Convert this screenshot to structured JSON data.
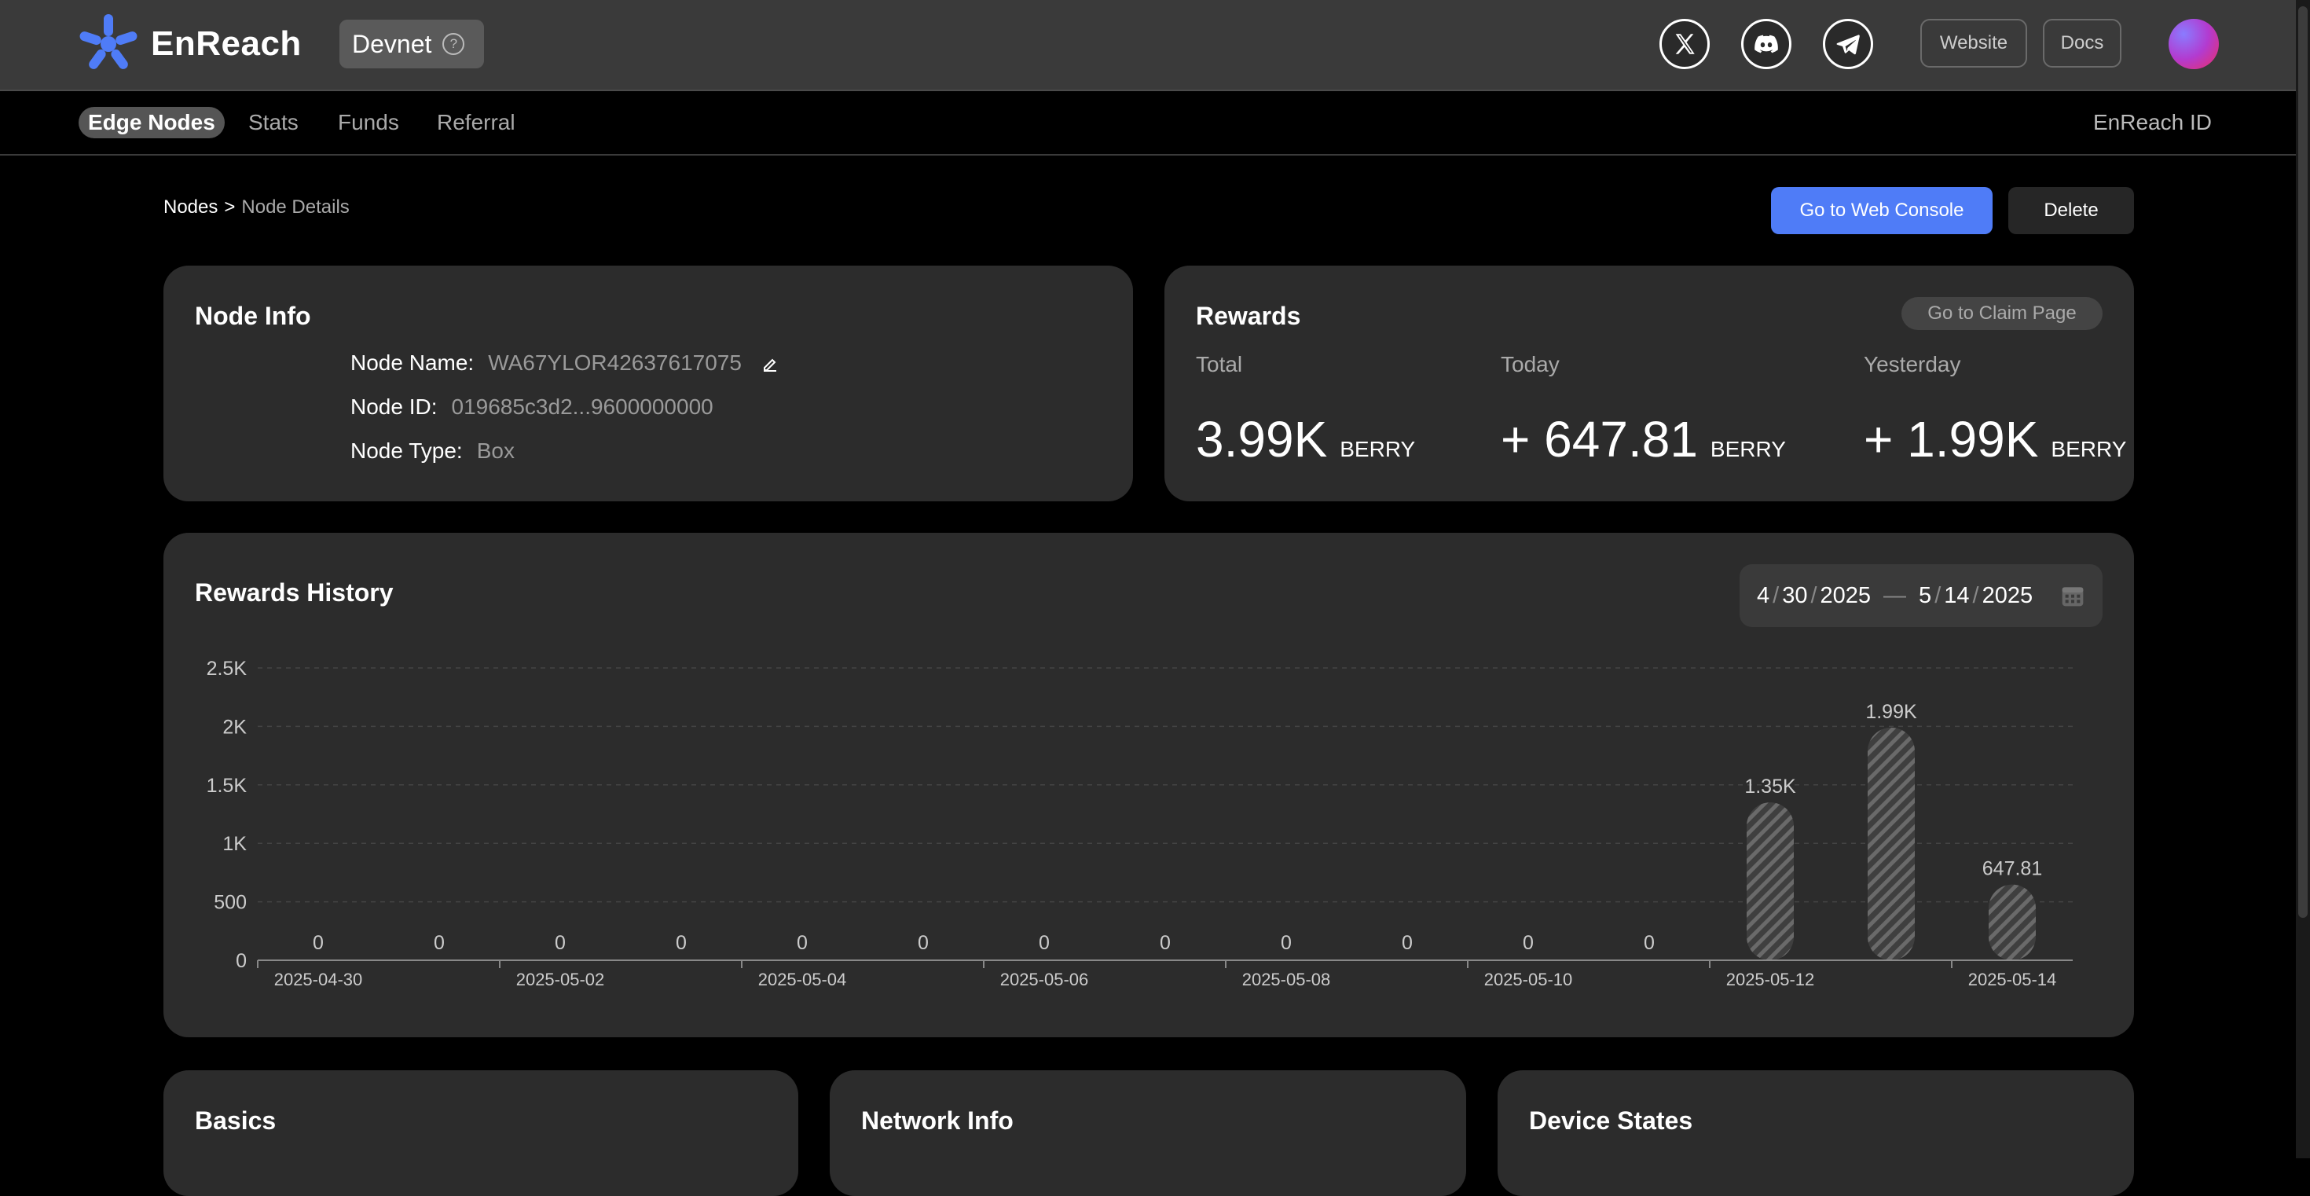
{
  "app": {
    "name": "EnReach",
    "env": "Devnet"
  },
  "header": {
    "website_label": "Website",
    "docs_label": "Docs"
  },
  "nav": {
    "items": [
      "Edge Nodes",
      "Stats",
      "Funds",
      "Referral"
    ],
    "active": "Edge Nodes",
    "right_link": "EnReach ID"
  },
  "breadcrumb": {
    "root": "Nodes",
    "sep": ">",
    "current": "Node Details"
  },
  "actions": {
    "web_console": "Go to Web Console",
    "delete": "Delete"
  },
  "node_info": {
    "title": "Node Info",
    "name_label": "Node Name:",
    "name_value": "WA67YLOR42637617075",
    "id_label": "Node ID:",
    "id_value": "019685c3d2...9600000000",
    "type_label": "Node Type:",
    "type_value": "Box"
  },
  "rewards": {
    "title": "Rewards",
    "claim_label": "Go to Claim Page",
    "total_label": "Total",
    "total_value": "3.99K",
    "today_label": "Today",
    "today_value": "+ 647.81",
    "yesterday_label": "Yesterday",
    "yesterday_value": "+ 1.99K",
    "unit": "BERRY"
  },
  "history": {
    "title": "Rewards History",
    "start": {
      "m": "4",
      "d": "30",
      "y": "2025"
    },
    "end": {
      "m": "5",
      "d": "14",
      "y": "2025"
    },
    "dash": "—"
  },
  "chart_data": {
    "type": "bar",
    "categories": [
      "2025-04-30",
      "2025-05-01",
      "2025-05-02",
      "2025-05-03",
      "2025-05-04",
      "2025-05-05",
      "2025-05-06",
      "2025-05-07",
      "2025-05-08",
      "2025-05-09",
      "2025-05-10",
      "2025-05-11",
      "2025-05-12",
      "2025-05-13",
      "2025-05-14"
    ],
    "x_tick_labels": [
      "2025-04-30",
      "2025-05-02",
      "2025-05-04",
      "2025-05-06",
      "2025-05-08",
      "2025-05-10",
      "2025-05-12",
      "2025-05-14"
    ],
    "values": [
      0,
      0,
      0,
      0,
      0,
      0,
      0,
      0,
      0,
      0,
      0,
      0,
      1350,
      1990,
      647.81
    ],
    "data_labels": [
      "0",
      "0",
      "0",
      "0",
      "0",
      "0",
      "0",
      "0",
      "0",
      "0",
      "0",
      "0",
      "1.35K",
      "1.99K",
      "647.81"
    ],
    "y_ticks": [
      0,
      500,
      1000,
      1500,
      2000,
      2500
    ],
    "y_tick_labels": [
      "0",
      "500",
      "1K",
      "1.5K",
      "2K",
      "2.5K"
    ],
    "ylim": [
      0,
      2500
    ],
    "grid": true,
    "title": "Rewards History",
    "xlabel": "",
    "ylabel": ""
  },
  "bottom_cards": [
    "Basics",
    "Network Info",
    "Device States"
  ]
}
